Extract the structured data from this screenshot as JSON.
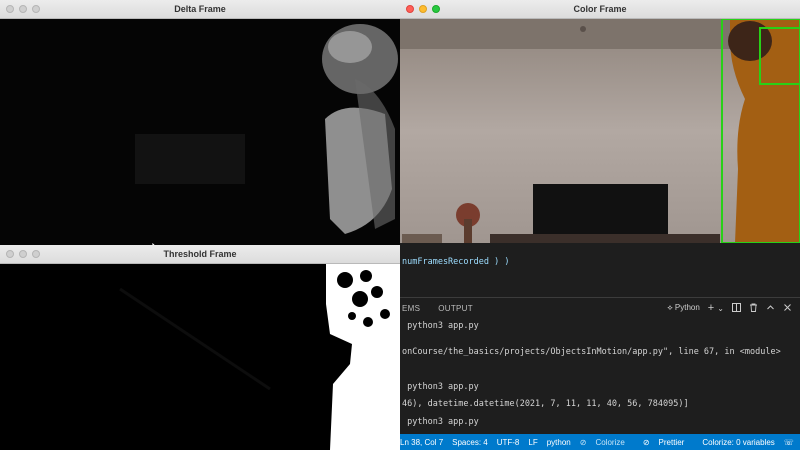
{
  "windows": {
    "delta": {
      "title": "Delta Frame"
    },
    "threshold": {
      "title": "Threshold Frame"
    },
    "color": {
      "title": "Color Frame"
    }
  },
  "editor": {
    "code_line": "numFramesRecorded ) )"
  },
  "panel": {
    "tabs": [
      "EMS",
      "OUTPUT"
    ],
    "terminal_label": "Python",
    "plus": "+",
    "chevron": "⌄"
  },
  "terminal": {
    "lines": [
      " python3 app.py",
      "onCourse/the_basics/projects/ObjectsInMotion/app.py\", line 67, in <module>",
      " python3 app.py",
      "46), datetime.datetime(2021, 7, 11, 11, 40, 56, 784095)]",
      " python3 app.py"
    ]
  },
  "statusbar": {
    "position": "Ln 38, Col 7",
    "spaces": "Spaces: 4",
    "encoding": "UTF-8",
    "eol": "LF",
    "language": "python",
    "colorize": "Colorize",
    "prettier": "Prettier",
    "colorize_vars": "Colorize: 0 variables"
  },
  "colors": {
    "statusbar_bg": "#007acc",
    "detection_box": "#28d017"
  }
}
